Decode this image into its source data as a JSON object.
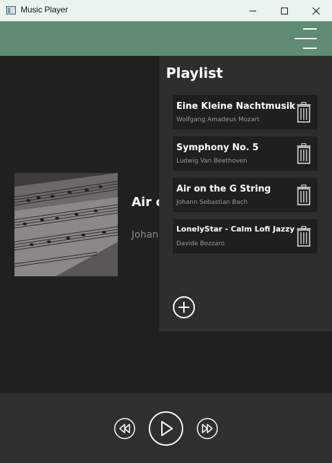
{
  "window": {
    "title": "Music Player",
    "icons": {
      "app": "app-icon",
      "minimize": "minimize-icon",
      "maximize": "maximize-icon",
      "close": "close-icon"
    }
  },
  "header": {
    "menu_icon": "hamburger-menu-icon",
    "color": "#5f8c72"
  },
  "now_playing": {
    "title": "Air on the G String",
    "title_visible": "Air o",
    "artist": "Johann Sebastian Bach",
    "artist_visible": "Johan",
    "art": "sheet-music-album-art"
  },
  "playlist": {
    "title": "Playlist",
    "tracks": [
      {
        "title": "Eine Kleine Nachtmusik",
        "artist": "Wolfgang Amadeus Mozart"
      },
      {
        "title": "Symphony No. 5",
        "artist": "Ludwig Van Beethoven"
      },
      {
        "title": "Air on the G String",
        "artist": "Johann Sebastian Bach"
      },
      {
        "title": "LonelyStar - Calm Lofi Jazzy",
        "artist": "Davide Bozzaro"
      }
    ],
    "delete_icon": "trash-icon",
    "add_icon": "add-circle-icon"
  },
  "controls": {
    "rewind_icon": "rewind-icon",
    "play_icon": "play-icon",
    "forward_icon": "fast-forward-icon"
  },
  "colors": {
    "background": "#202020",
    "panel": "#2e2e2e",
    "track_bg": "#1f1f1f",
    "accent": "#5f8c72"
  }
}
